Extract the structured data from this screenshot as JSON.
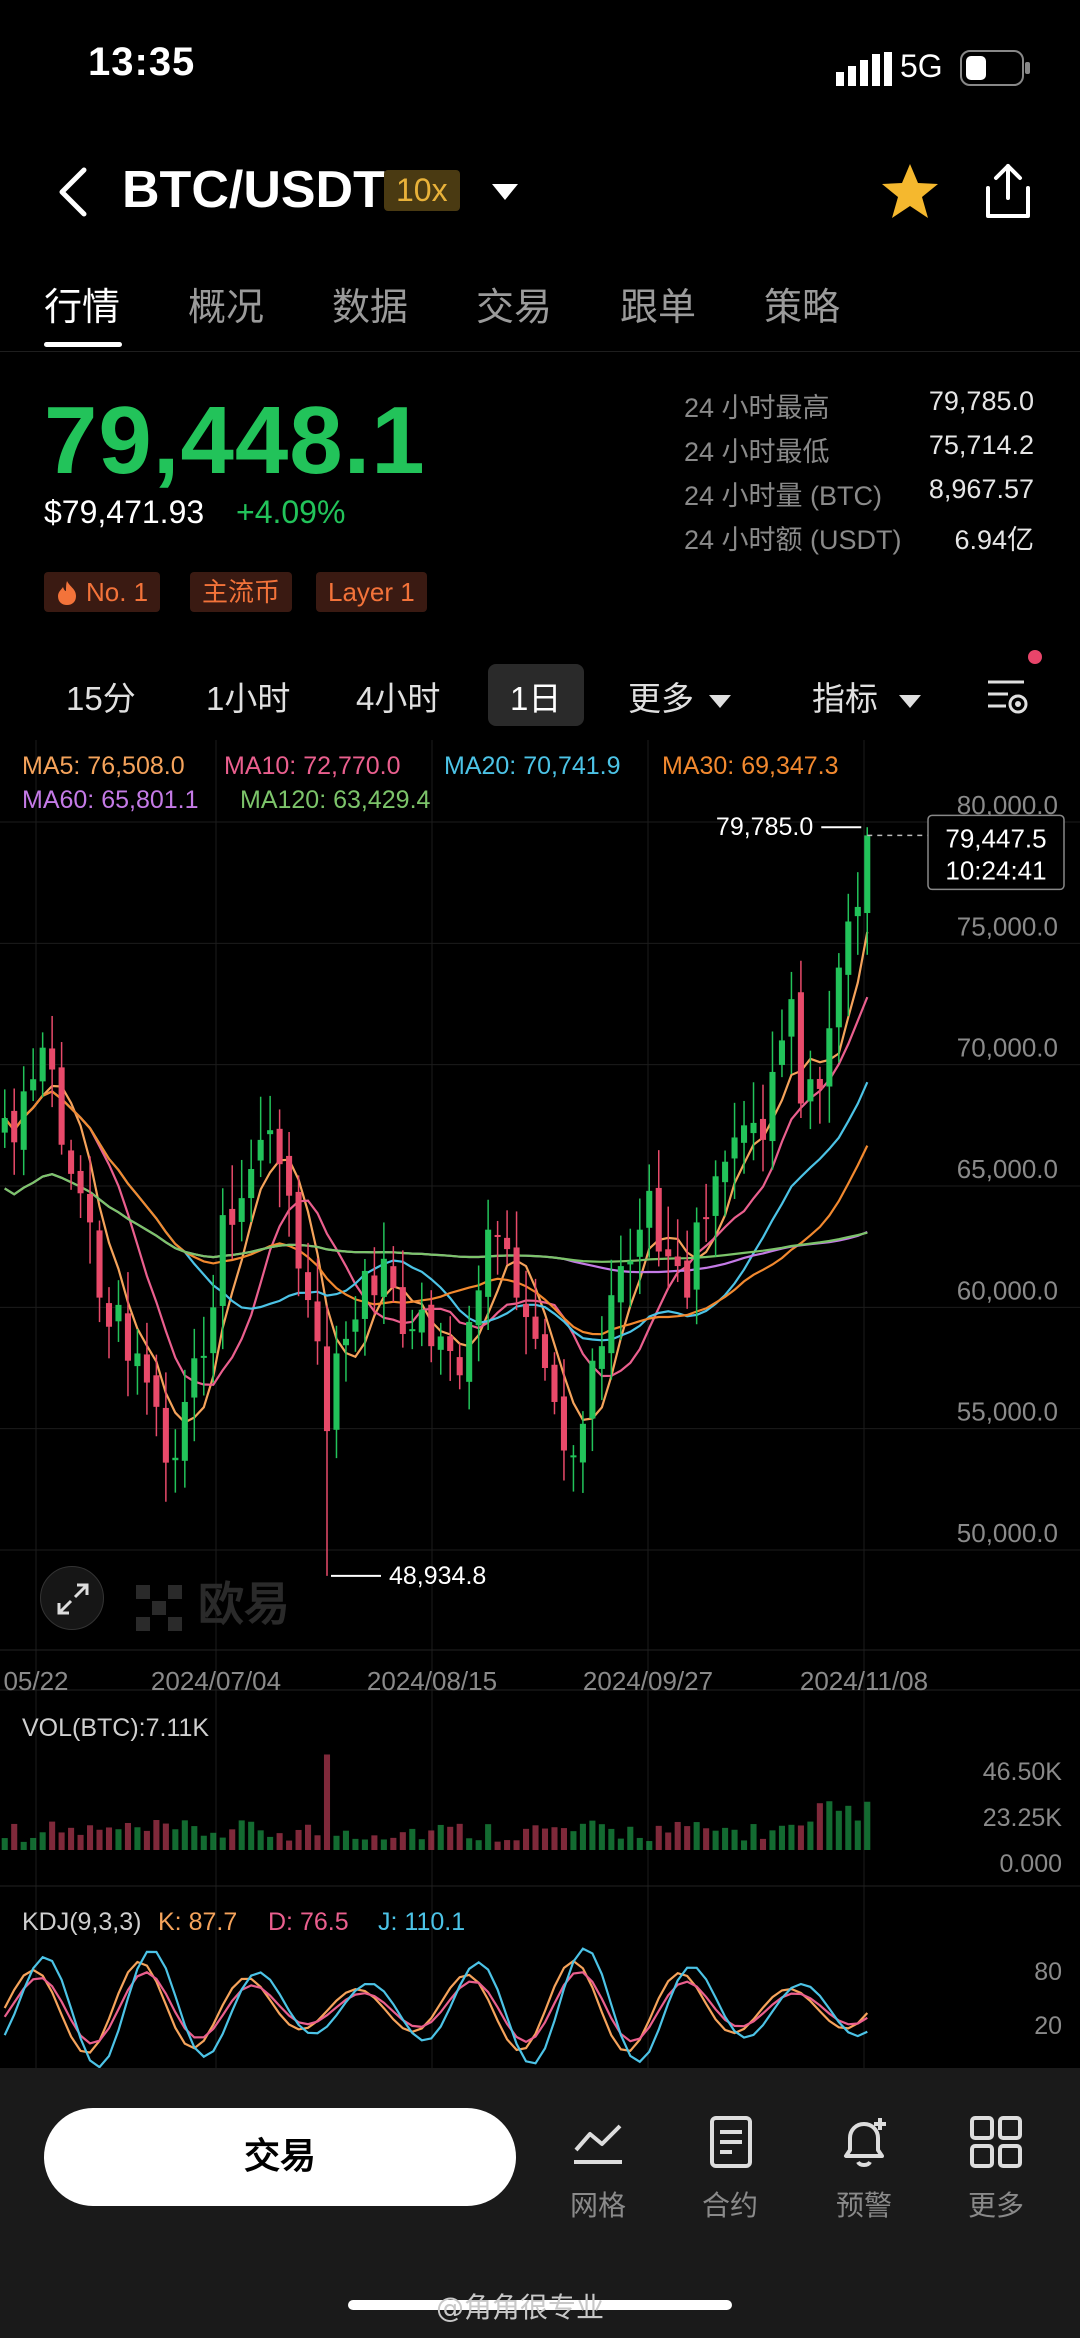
{
  "status_bar": {
    "time": "13:35",
    "network": "5G"
  },
  "header": {
    "pair": "BTC/USDT",
    "leverage": "10x"
  },
  "tabs": [
    {
      "label": "行情",
      "active": true
    },
    {
      "label": "概况"
    },
    {
      "label": "数据"
    },
    {
      "label": "交易"
    },
    {
      "label": "跟单"
    },
    {
      "label": "策略"
    }
  ],
  "price": {
    "last": "79,448.1",
    "usd": "$79,471.93",
    "change_pct": "+4.09%"
  },
  "stats": [
    {
      "label": "24 小时最高",
      "value": "79,785.0"
    },
    {
      "label": "24 小时最低",
      "value": "75,714.2"
    },
    {
      "label": "24 小时量 (BTC)",
      "value": "8,967.57"
    },
    {
      "label": "24 小时额 (USDT)",
      "value": "6.94亿"
    }
  ],
  "tags": [
    "No. 1",
    "主流币",
    "Layer 1"
  ],
  "timeframes": {
    "items": [
      "15分",
      "1小时",
      "4小时",
      "1日"
    ],
    "active": "1日",
    "more": "更多",
    "indicators": "指标"
  },
  "ma_legend": [
    {
      "label": "MA5: 76,508.0",
      "color": "#f5a35b"
    },
    {
      "label": "MA10: 72,770.0",
      "color": "#ea5f8e"
    },
    {
      "label": "MA20: 70,741.9",
      "color": "#4cc3e6"
    },
    {
      "label": "MA30: 69,347.3",
      "color": "#f2892f"
    },
    {
      "label": "MA60: 65,801.1",
      "color": "#c47ae6"
    },
    {
      "label": "MA120: 63,429.4",
      "color": "#7cc46a"
    }
  ],
  "chart_data": {
    "type": "candlestick",
    "y_ticks": [
      "80,000.0",
      "75,000.0",
      "70,000.0",
      "65,000.0",
      "60,000.0",
      "55,000.0",
      "50,000.0"
    ],
    "ylim": [
      47500,
      81000
    ],
    "x_ticks": [
      "05/22",
      "2024/07/04",
      "2024/08/15",
      "2024/09/27",
      "2024/11/08"
    ],
    "high_label": "79,785.0",
    "low_label": "48,934.8",
    "current_price": "79,447.5",
    "countdown": "10:24:41",
    "colors": {
      "up": "#22c35a",
      "down": "#e84a6a"
    },
    "ma_colors": [
      "#f5a35b",
      "#ea5f8e",
      "#4cc3e6",
      "#f2892f",
      "#c47ae6",
      "#7cc46a"
    ],
    "closes": [
      67800,
      66800,
      68900,
      69400,
      70700,
      69800,
      66700,
      65500,
      64700,
      63500,
      60400,
      59200,
      60100,
      57800,
      58100,
      56900,
      55900,
      53600,
      53800,
      56100,
      57900,
      58000,
      60000,
      63800,
      63400,
      64500,
      65700,
      66900,
      67300,
      65900,
      64600,
      61600,
      60300,
      58600,
      54900,
      58100,
      58700,
      59500,
      61500,
      60500,
      62000,
      60800,
      58900,
      59100,
      59900,
      58400,
      58800,
      58200,
      57200,
      59400,
      60700,
      63200,
      62900,
      62400,
      60400,
      59600,
      58700,
      57500,
      56100,
      54100,
      53900,
      55200,
      57800,
      58400,
      60500,
      61700,
      61900,
      63200,
      64800,
      62300,
      62100,
      61700,
      60400,
      63500,
      63700,
      65400,
      66000,
      67000,
      67500,
      67600,
      66900,
      69700,
      71000,
      72700,
      68400,
      69400,
      69000,
      71500,
      74000,
      75900,
      76500,
      79448
    ],
    "volume": {
      "label": "VOL(BTC):7.11K",
      "ticks": [
        "46.50K",
        "23.25K",
        "0.000"
      ]
    },
    "kdj": {
      "label": "KDJ(9,3,3)",
      "k": "K: 87.7",
      "d": "D: 76.5",
      "j": "J: 110.1",
      "ticks": [
        "80",
        "20"
      ]
    }
  },
  "watermark": "欧易",
  "bottom_nav": {
    "trade": "交易",
    "items": [
      "网格",
      "合约",
      "预警",
      "更多"
    ]
  },
  "weibo": "@角角很专业"
}
